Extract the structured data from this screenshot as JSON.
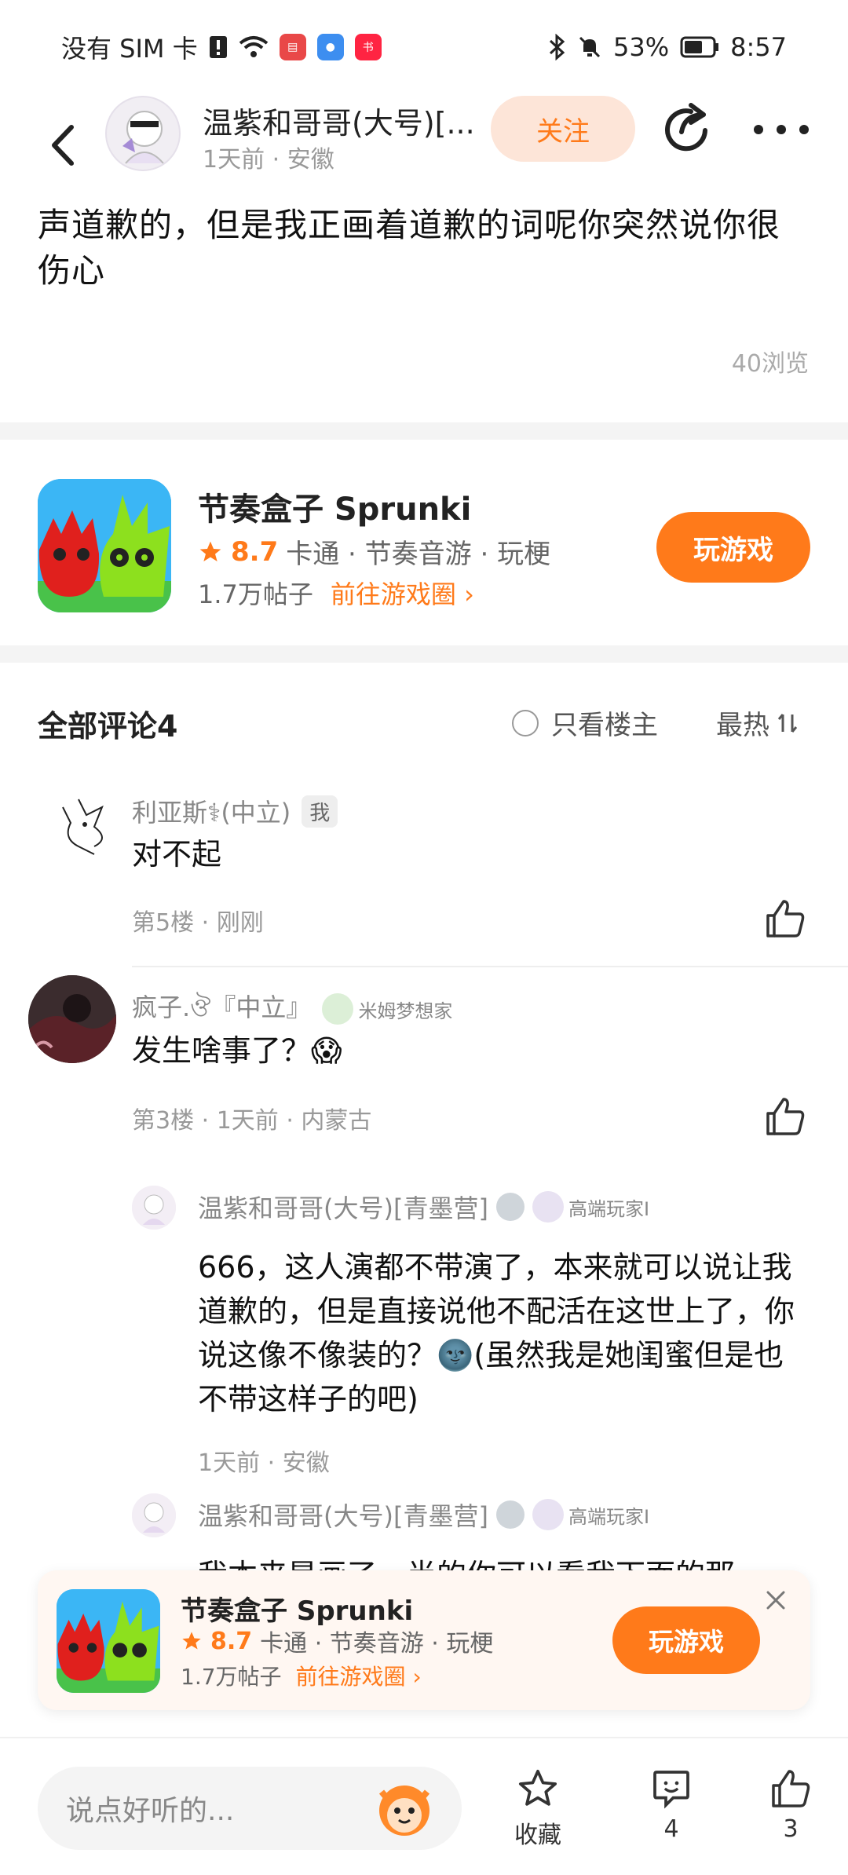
{
  "status_bar": {
    "carrier": "没有 SIM 卡",
    "battery": "53%",
    "time": "8:57",
    "icons": [
      "sim-alert-icon",
      "wifi-icon",
      "app-icon-red",
      "app-icon-blue",
      "app-icon-xiaohongshu",
      "bluetooth-icon",
      "mute-icon",
      "battery-icon"
    ]
  },
  "header": {
    "author_name": "温紫和哥哥(大号)[...",
    "meta": "1天前 · 安徽",
    "follow_label": "关注"
  },
  "post": {
    "text": "声道歉的，但是我正画着道歉的词呢你突然说你很伤心",
    "views": "40浏览"
  },
  "game": {
    "title": "节奏盒子 Sprunki",
    "rating": "8.7",
    "tags": "卡通 · 节奏音游 · 玩梗",
    "posts": "1.7万帖子",
    "circle_link": "前往游戏圈",
    "play_label": "玩游戏"
  },
  "comments_header": {
    "title": "全部评论4",
    "only_op": "只看楼主",
    "sort": "最热"
  },
  "comments": [
    {
      "name": "利亚斯⚕(中立)",
      "tag": "我",
      "text": "对不起",
      "meta": "第5楼 · 刚刚"
    },
    {
      "name": "疯子.ঔ『中立』",
      "badge": "米姆梦想家",
      "text": "发生啥事了？😱",
      "meta": "第3楼 · 1天前 · 内蒙古"
    }
  ],
  "replies": [
    {
      "name": "温紫和哥哥(大号)[青墨营]",
      "badge": "高端玩家I",
      "text": "666，这人演都不带演了，本来就可以说让我道歉的，但是直接说他不配活在这世上了，你说这像不像装的？🌚(虽然我是她闺蜜但是也不带这样子的吧)",
      "meta": "1天前 · 安徽"
    },
    {
      "name": "温紫和哥哥(大号)[青墨营]",
      "badge": "高端玩家I",
      "text": "我本来是画了一半的你可以看我下面的那"
    }
  ],
  "bottom": {
    "input_placeholder": "说点好听的...",
    "favorite_label": "收藏",
    "comment_count": "4",
    "like_count": "3"
  },
  "colors": {
    "accent": "#ff7a1a",
    "follow_bg": "#fde5d8"
  }
}
